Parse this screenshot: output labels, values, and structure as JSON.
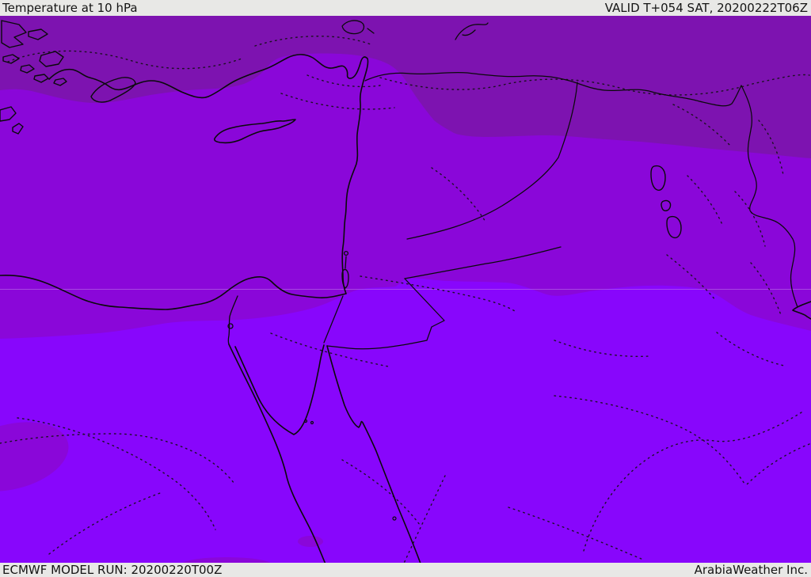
{
  "header": {
    "title": "Temperature at 10 hPa",
    "valid_time": "VALID T+054 SAT, 20200222T06Z"
  },
  "footer": {
    "model_run": "ECMWF MODEL RUN: 20200220T00Z",
    "brand": "ArabiaWeather Inc."
  },
  "map": {
    "type": "weather-model-temperature-map",
    "parameter": "Temperature at 10 hPa",
    "colors": {
      "chrome_bg": "#E8E8E6",
      "chrome_text": "#141414",
      "band_coldest": "#7D13B0",
      "band_mid": "#8A07D9",
      "band_warmest": "#8806FC",
      "coastline": "#0A0A0A",
      "contour_dots": "#111111",
      "graticule": "#C07CE8"
    },
    "features": [
      "Aegean islands",
      "Turkey south coast",
      "Cyprus",
      "Levant coast",
      "Nile Delta",
      "Sinai Peninsula",
      "Red Sea",
      "Gulf of Aqaba",
      "Lake Urmia",
      "Persian Gulf tip"
    ]
  }
}
